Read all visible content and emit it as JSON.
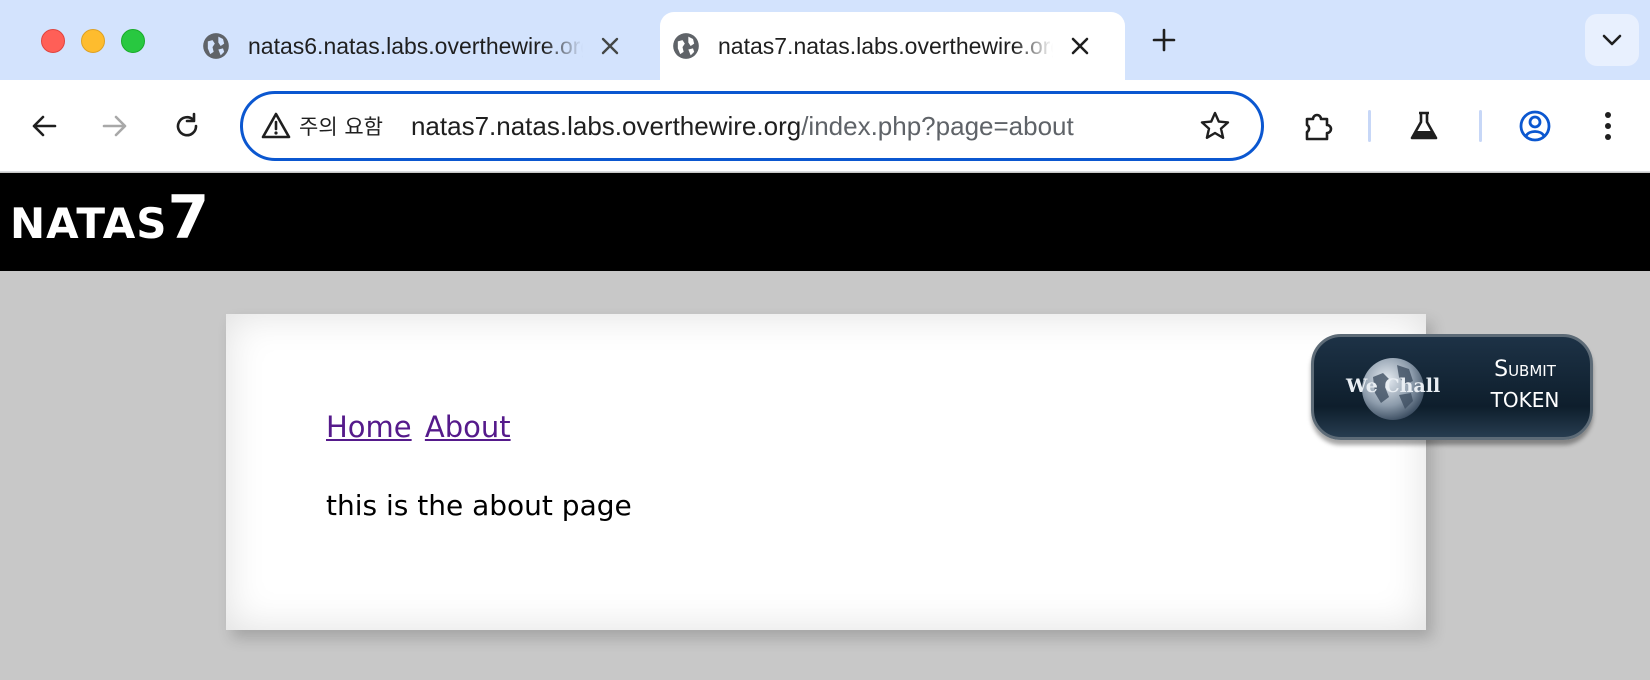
{
  "browser": {
    "tabs": [
      {
        "title": "natas6.natas.labs.overthewire.org",
        "active": false
      },
      {
        "title": "natas7.natas.labs.overthewire.org",
        "active": true
      }
    ],
    "address_bar": {
      "security_label": "주의 요함",
      "url_host": "natas7.natas.labs.overthewire.org",
      "url_path": "/index.php?page=about"
    },
    "icons": [
      "globe-icon",
      "close-icon",
      "plus-icon",
      "chevron-down-icon",
      "back-arrow-icon",
      "forward-arrow-icon",
      "reload-icon",
      "warning-icon",
      "star-icon",
      "extensions-icon",
      "labs-flask-icon",
      "profile-icon",
      "more-vert-icon"
    ],
    "accent_color": "#0b57d0"
  },
  "page": {
    "logo_text": "NATAS",
    "logo_number": "7",
    "nav": {
      "home": "Home",
      "about": "About"
    },
    "body_text": "this is the about page",
    "wechall": {
      "brand": "We Chall",
      "line1": "Submit",
      "line2": "token"
    },
    "link_color": "#551a8b"
  }
}
